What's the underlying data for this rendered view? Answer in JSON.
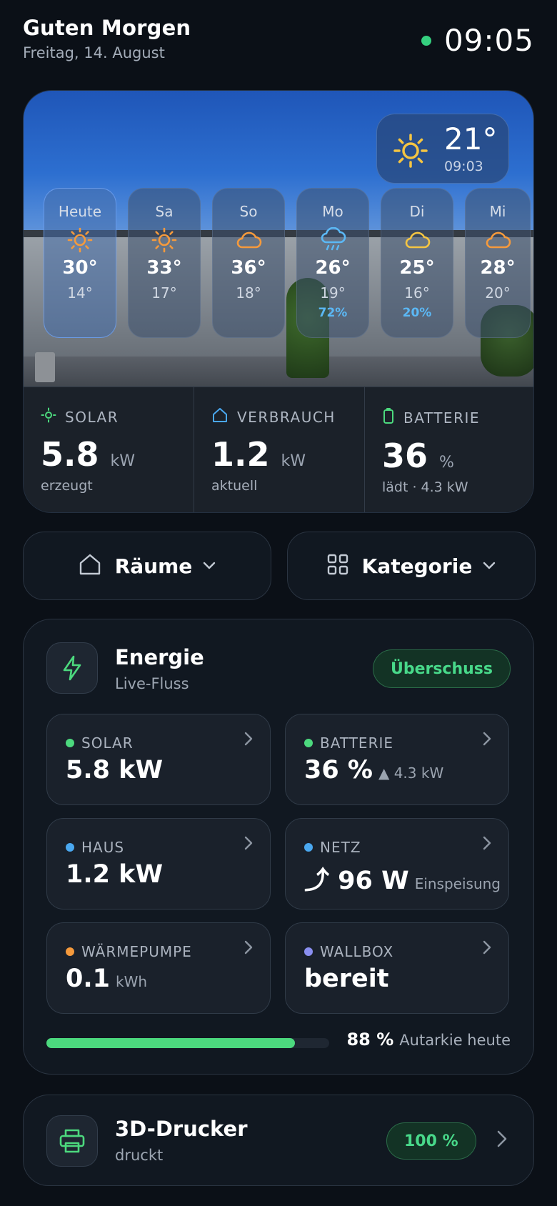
{
  "header": {
    "greeting": "Guten Morgen",
    "date": "Freitag, 14. August",
    "time": "09:05",
    "status_color": "#35d07f"
  },
  "weather": {
    "now": {
      "temp": "21°",
      "time": "09:03",
      "icon": "sun-icon"
    },
    "forecast": [
      {
        "day": "Heute",
        "icon": "sun-icon",
        "hi": "30°",
        "lo": "14°",
        "rain": ""
      },
      {
        "day": "Sa",
        "icon": "sun-icon",
        "hi": "33°",
        "lo": "17°",
        "rain": ""
      },
      {
        "day": "So",
        "icon": "cloud-icon",
        "hi": "36°",
        "lo": "18°",
        "rain": ""
      },
      {
        "day": "Mo",
        "icon": "rain-cloud-icon",
        "hi": "26°",
        "lo": "19°",
        "rain": "72%"
      },
      {
        "day": "Di",
        "icon": "cloud-icon",
        "hi": "25°",
        "lo": "16°",
        "rain": "20%"
      },
      {
        "day": "Mi",
        "icon": "cloud-icon",
        "hi": "28°",
        "lo": "20°",
        "rain": ""
      }
    ]
  },
  "stats": [
    {
      "label": "SOLAR",
      "value": "5.8",
      "unit": "kW",
      "sub": "erzeugt",
      "icon": "sun-outline-icon",
      "color": "#4cd97e"
    },
    {
      "label": "VERBRAUCH",
      "value": "1.2",
      "unit": "kW",
      "sub": "aktuell",
      "icon": "home-icon",
      "color": "#4aa8f0"
    },
    {
      "label": "BATTERIE",
      "value": "36",
      "unit": "%",
      "sub": "lädt · 4.3 kW",
      "icon": "battery-icon",
      "color": "#4cd97e"
    }
  ],
  "filters": {
    "rooms": {
      "label": "Räume",
      "icon": "home-icon"
    },
    "category": {
      "label": "Kategorie",
      "icon": "grid-icon"
    }
  },
  "energy": {
    "title": "Energie",
    "subtitle": "Live-Fluss",
    "badge": "Überschuss",
    "tiles": [
      {
        "label": "SOLAR",
        "value": "5.8 kW",
        "extra": "",
        "color": "#4cd97e"
      },
      {
        "label": "BATTERIE",
        "value": "36 %",
        "extra": "▲ 4.3 kW",
        "color": "#4cd97e"
      },
      {
        "label": "HAUS",
        "value": "1.2 kW",
        "extra": "",
        "color": "#4aa8f0"
      },
      {
        "label": "NETZ",
        "value": "⤴ 96 W",
        "extra": "Einspeisung",
        "color": "#4aa8f0"
      },
      {
        "label": "WÄRMEPUMPE",
        "value": "0.1",
        "extra": "kWh",
        "color": "#f59a3c"
      },
      {
        "label": "WALLBOX",
        "value": "bereit",
        "extra": "",
        "color": "#8a8ff0"
      }
    ],
    "autarky": {
      "value": "88 %",
      "label": "Autarkie heute",
      "fraction": 0.88
    }
  },
  "printer": {
    "title": "3D-Drucker",
    "status": "druckt",
    "progress": "100 %"
  }
}
